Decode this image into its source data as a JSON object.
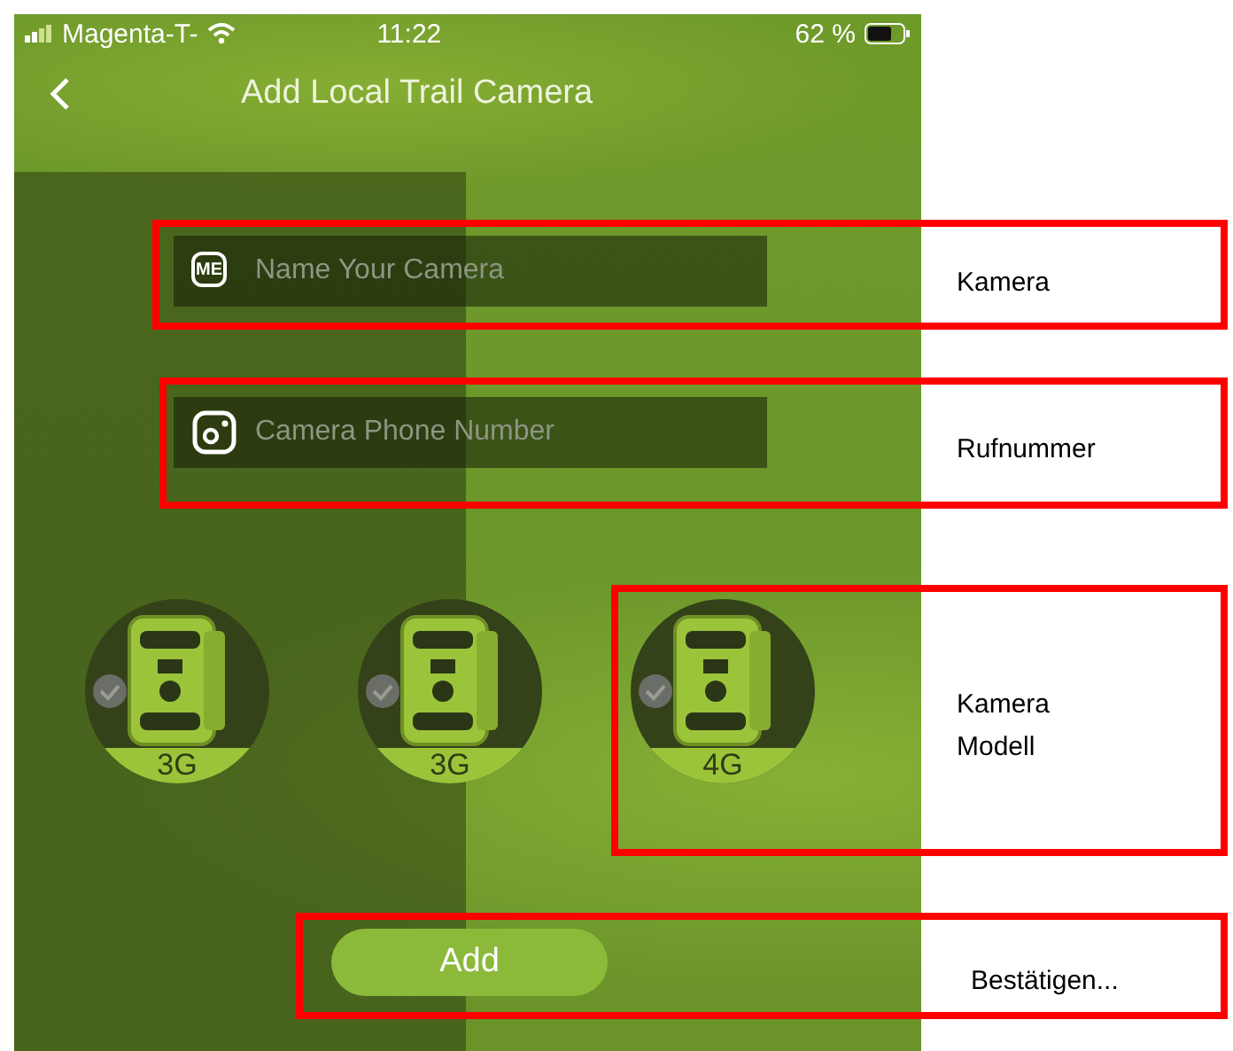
{
  "status_bar": {
    "carrier": "Magenta-T-",
    "time": "11:22",
    "battery": "62 %"
  },
  "header": {
    "title": "Add Local Trail Camera"
  },
  "fields": [
    {
      "kind": "name",
      "icon_label": "ME",
      "placeholder": "Name Your Camera"
    },
    {
      "kind": "phone",
      "placeholder": "Camera Phone Number"
    }
  ],
  "camera_models": [
    {
      "label": "3G",
      "selected": false
    },
    {
      "label": "3G",
      "selected": false
    },
    {
      "label": "4G",
      "selected": false
    }
  ],
  "add_button": {
    "label": "Add"
  },
  "annotations": [
    {
      "label": "Kamera"
    },
    {
      "label": "Rufnummer"
    },
    {
      "label": "Kamera Modell"
    },
    {
      "label": "Bestätigen..."
    }
  ]
}
